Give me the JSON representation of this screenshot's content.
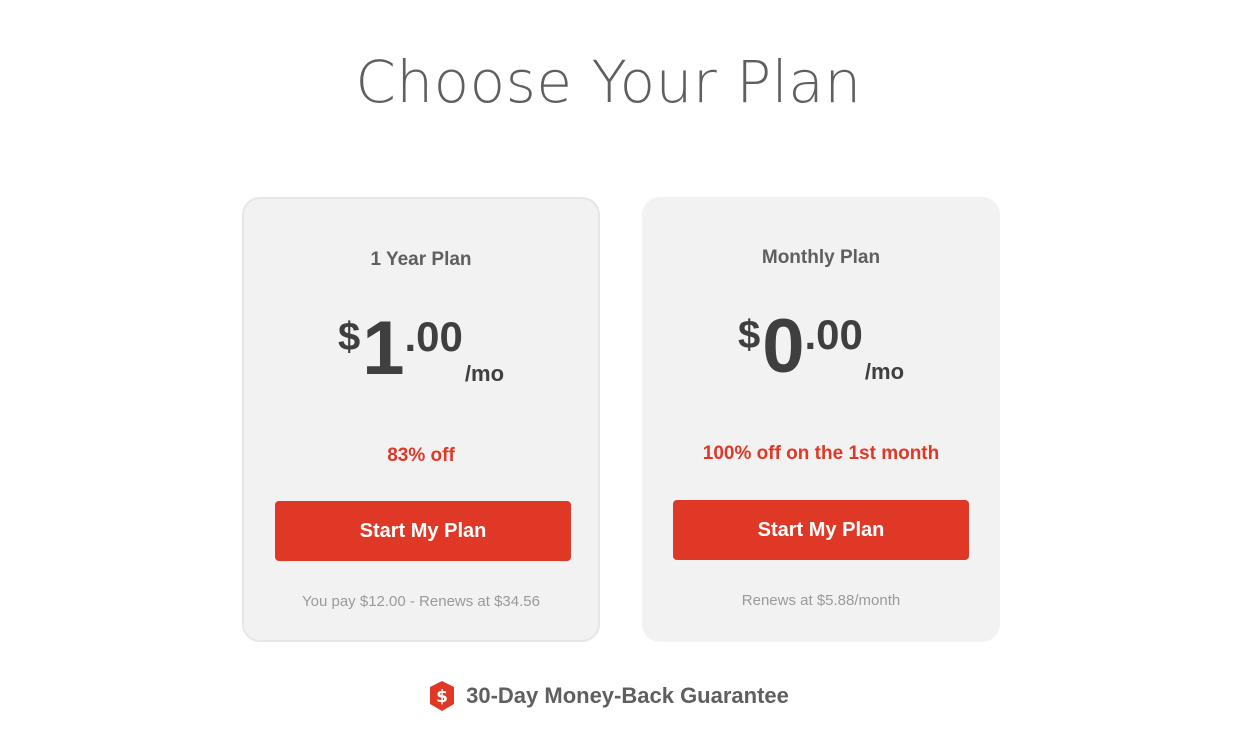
{
  "header": {
    "title": "Choose Your Plan"
  },
  "plans": [
    {
      "name": "1 Year Plan",
      "currency": "$",
      "price_whole": "1",
      "price_cents": ".00",
      "period": "/mo",
      "discount": "83% off",
      "cta_label": "Start My Plan",
      "note": "You pay $12.00 - Renews at $34.56"
    },
    {
      "name": "Monthly Plan",
      "currency": "$",
      "price_whole": "0",
      "price_cents": ".00",
      "period": "/mo",
      "discount": "100% off on the 1st month",
      "cta_label": "Start My Plan",
      "note": "Renews at $5.88/month"
    }
  ],
  "guarantee": {
    "icon": "dollar-shield-icon",
    "text": "30-Day Money-Back Guarantee"
  },
  "colors": {
    "accent": "#df3826",
    "card_background": "#f2f2f2",
    "heading_text": "#5f5f5f",
    "price_text": "#3f3f3f",
    "muted_text": "#9a9a9a"
  }
}
